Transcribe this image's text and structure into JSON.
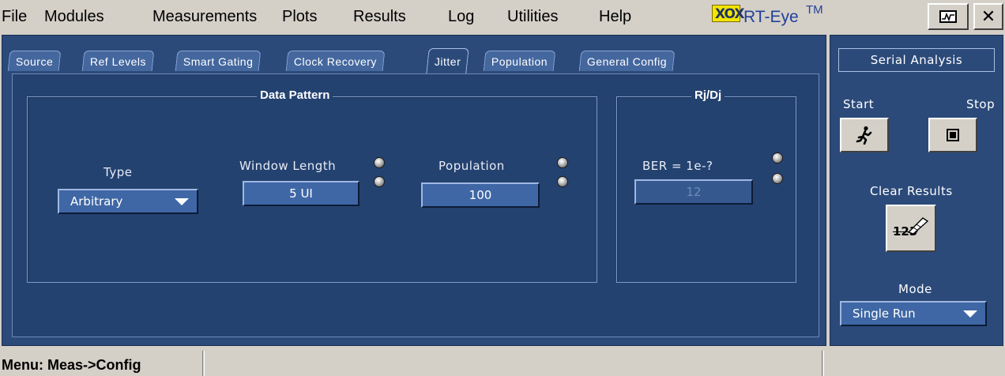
{
  "menu": {
    "items": [
      "File",
      "Modules",
      "Measurements",
      "Plots",
      "Results",
      "Log",
      "Utilities",
      "Help"
    ],
    "brand": "RT-Eye",
    "brand_tm": "TM",
    "close": "✕"
  },
  "tabs": [
    {
      "label": "Source",
      "active": false
    },
    {
      "label": "Ref Levels",
      "active": false
    },
    {
      "label": "Smart Gating",
      "active": false
    },
    {
      "label": "Clock Recovery",
      "active": false
    },
    {
      "label": "Jitter",
      "active": true
    },
    {
      "label": "Population",
      "active": false
    },
    {
      "label": "General Config",
      "active": false
    }
  ],
  "data_pattern": {
    "title": "Data Pattern",
    "type_label": "Type",
    "type_value": "Arbitrary",
    "window_length_label": "Window Length",
    "window_length_value": "5 UI",
    "population_label": "Population",
    "population_value": "100"
  },
  "rjdj": {
    "title": "Rj/Dj",
    "ber_label": "BER = 1e-?",
    "ber_value": "12"
  },
  "side": {
    "title": "Serial Analysis",
    "start_label": "Start",
    "stop_label": "Stop",
    "clear_label": "Clear Results",
    "clear_icon_text": "123",
    "mode_label": "Mode",
    "mode_value": "Single Run"
  },
  "status": {
    "text": "Menu: Meas->Config"
  }
}
